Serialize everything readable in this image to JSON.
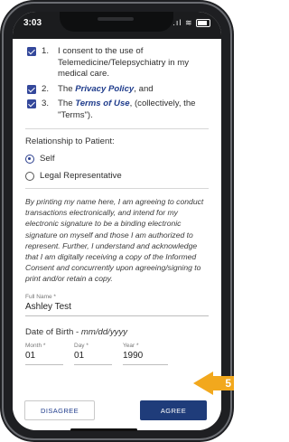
{
  "status_bar": {
    "time": "3:03",
    "signal": ".ıl",
    "wifi": "≋"
  },
  "consents": [
    {
      "number": "1.",
      "text": "I consent to the use of Telemedicine/Telepsychiatry in my medical care."
    },
    {
      "number": "2.",
      "pre": "The ",
      "link": "Privacy Policy",
      "post": ", and"
    },
    {
      "number": "3.",
      "pre": "The ",
      "link": "Terms of Use",
      "post": ", (collectively, the \"Terms\")."
    }
  ],
  "relationship": {
    "label": "Relationship to Patient:",
    "options": [
      "Self",
      "Legal Representative"
    ],
    "selected": "Self"
  },
  "disclaimer": "By printing my name here, I am agreeing to conduct transactions electronically, and intend for my electronic signature to be a binding electronic signature on myself and those I am authorized to represent. Further, I understand and acknowledge that I am digitally receiving a copy of the Informed Consent and concurrently upon agreeing/signing to print and/or retain a copy.",
  "full_name": {
    "label": "Full Name *",
    "value": "Ashley Test"
  },
  "dob": {
    "title": "Date of Birth - ",
    "hint": "mm/dd/yyyy",
    "month": {
      "label": "Month *",
      "value": "01"
    },
    "day": {
      "label": "Day *",
      "value": "01"
    },
    "year": {
      "label": "Year *",
      "value": "1990"
    }
  },
  "buttons": {
    "disagree": "DISAGREE",
    "agree": "AGREE"
  },
  "step_badge": "5",
  "colors": {
    "primary": "#1f3c7a",
    "link": "#1f3c8c",
    "badge": "#f2a81d"
  }
}
